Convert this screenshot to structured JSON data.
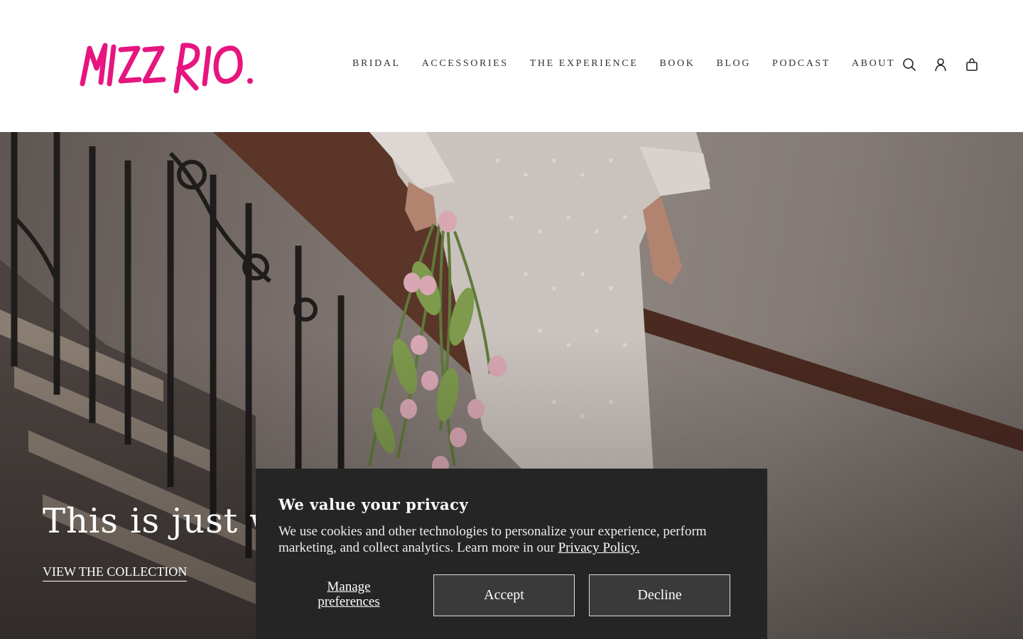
{
  "brand": {
    "logo_text": "MIZZ RIO.",
    "accent": "#e6157f"
  },
  "nav": {
    "items": [
      {
        "label": "BRIDAL"
      },
      {
        "label": "ACCESSORIES"
      },
      {
        "label": "THE EXPERIENCE"
      },
      {
        "label": "BOOK"
      },
      {
        "label": "BLOG"
      },
      {
        "label": "PODCAST"
      },
      {
        "label": "ABOUT"
      }
    ],
    "icons": [
      "search-icon",
      "account-icon",
      "cart-icon"
    ]
  },
  "hero": {
    "title": "This is just wi",
    "link": "VIEW THE COLLECTION"
  },
  "cookie": {
    "title": "We value your privacy",
    "body": "We use cookies and other technologies to personalize your experience, perform marketing, and collect analytics. Learn more in our ",
    "policy_link": "Privacy Policy.",
    "manage_line1": "Manage",
    "manage_line2": "preferences",
    "accept": "Accept",
    "decline": "Decline",
    "bg_color": "#252525"
  }
}
